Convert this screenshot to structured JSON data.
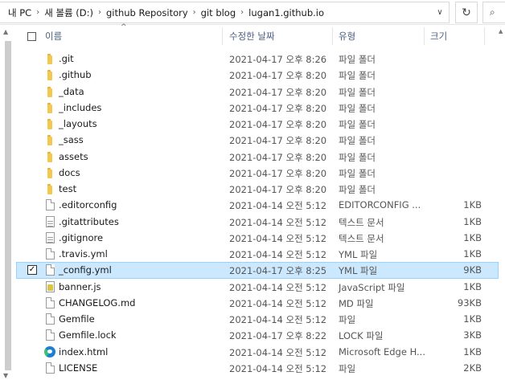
{
  "address": {
    "crumbs": [
      "내 PC",
      "새 볼륨 (D:)",
      "github Repository",
      "git blog",
      "lugan1.github.io"
    ],
    "refresh_glyph": "↻",
    "search_glyph": "⌕"
  },
  "columns": {
    "name": "이름",
    "date": "수정한 날짜",
    "type": "유형",
    "size": "크기"
  },
  "files": [
    {
      "name": ".git",
      "date": "2021-04-17 오후 8:26",
      "type": "파일 폴더",
      "size": "",
      "icon": "folder"
    },
    {
      "name": ".github",
      "date": "2021-04-17 오후 8:20",
      "type": "파일 폴더",
      "size": "",
      "icon": "folder"
    },
    {
      "name": "_data",
      "date": "2021-04-17 오후 8:20",
      "type": "파일 폴더",
      "size": "",
      "icon": "folder"
    },
    {
      "name": "_includes",
      "date": "2021-04-17 오후 8:20",
      "type": "파일 폴더",
      "size": "",
      "icon": "folder"
    },
    {
      "name": "_layouts",
      "date": "2021-04-17 오후 8:20",
      "type": "파일 폴더",
      "size": "",
      "icon": "folder"
    },
    {
      "name": "_sass",
      "date": "2021-04-17 오후 8:20",
      "type": "파일 폴더",
      "size": "",
      "icon": "folder"
    },
    {
      "name": "assets",
      "date": "2021-04-17 오후 8:20",
      "type": "파일 폴더",
      "size": "",
      "icon": "folder"
    },
    {
      "name": "docs",
      "date": "2021-04-17 오후 8:20",
      "type": "파일 폴더",
      "size": "",
      "icon": "folder"
    },
    {
      "name": "test",
      "date": "2021-04-17 오후 8:20",
      "type": "파일 폴더",
      "size": "",
      "icon": "folder"
    },
    {
      "name": ".editorconfig",
      "date": "2021-04-14 오전 5:12",
      "type": "EDITORCONFIG ...",
      "size": "1KB",
      "icon": "doc"
    },
    {
      "name": ".gitattributes",
      "date": "2021-04-14 오전 5:12",
      "type": "텍스트 문서",
      "size": "1KB",
      "icon": "doctext"
    },
    {
      "name": ".gitignore",
      "date": "2021-04-14 오전 5:12",
      "type": "텍스트 문서",
      "size": "1KB",
      "icon": "doctext"
    },
    {
      "name": ".travis.yml",
      "date": "2021-04-14 오전 5:12",
      "type": "YML 파일",
      "size": "1KB",
      "icon": "doc"
    },
    {
      "name": "_config.yml",
      "date": "2021-04-17 오후 8:25",
      "type": "YML 파일",
      "size": "9KB",
      "icon": "doc",
      "selected": true
    },
    {
      "name": "banner.js",
      "date": "2021-04-14 오전 5:12",
      "type": "JavaScript 파일",
      "size": "1KB",
      "icon": "js"
    },
    {
      "name": "CHANGELOG.md",
      "date": "2021-04-14 오전 5:12",
      "type": "MD 파일",
      "size": "93KB",
      "icon": "doc"
    },
    {
      "name": "Gemfile",
      "date": "2021-04-14 오전 5:12",
      "type": "파일",
      "size": "1KB",
      "icon": "doc"
    },
    {
      "name": "Gemfile.lock",
      "date": "2021-04-17 오후 8:22",
      "type": "LOCK 파일",
      "size": "3KB",
      "icon": "doc"
    },
    {
      "name": "index.html",
      "date": "2021-04-14 오전 5:12",
      "type": "Microsoft Edge H...",
      "size": "1KB",
      "icon": "edge"
    },
    {
      "name": "LICENSE",
      "date": "2021-04-14 오전 5:12",
      "type": "파일",
      "size": "2KB",
      "icon": "doc"
    }
  ]
}
